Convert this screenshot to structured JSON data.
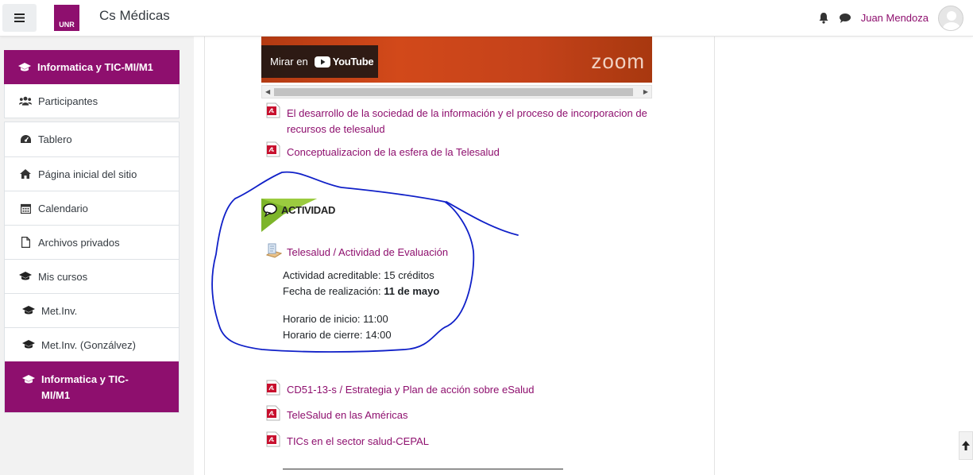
{
  "header": {
    "site_name": "Cs Médicas",
    "logo_text": "UNR",
    "user_name": "Juan Mendoza"
  },
  "drawer": {
    "course_title": "Informatica y TIC-MI/M1",
    "participants": "Participantes",
    "items": [
      {
        "label": "Tablero",
        "icon": "dashboard-icon"
      },
      {
        "label": "Página inicial del sitio",
        "icon": "home-icon"
      },
      {
        "label": "Calendario",
        "icon": "calendar-icon"
      },
      {
        "label": "Archivos privados",
        "icon": "file-icon"
      },
      {
        "label": "Mis cursos",
        "icon": "graduation-cap-icon"
      },
      {
        "label": "Met.Inv.",
        "icon": "graduation-cap-icon"
      },
      {
        "label": "Met.Inv. (Gonzálvez)",
        "icon": "graduation-cap-icon"
      }
    ],
    "active_course": "Informatica y TIC-MI/M1"
  },
  "video": {
    "watch_on": "Mirar en",
    "platform": "YouTube",
    "brand": "zoom"
  },
  "resources_top": [
    {
      "line1": "El desarrollo de la sociedad de la información y el proceso de incorporacion de",
      "line2": "recursos de telesalud"
    },
    {
      "line1": "Conceptualizacion de la esfera de la Telesalud"
    }
  ],
  "activity": {
    "banner": "ACTIVIDAD",
    "link": "Telesalud / Actividad de Evaluación",
    "credits": "Actividad acreditable: 15 créditos",
    "date_label": "Fecha de realización: ",
    "date_value": "11 de mayo",
    "start": "Horario de inicio: 11:00",
    "end": "Horario de cierre: 14:00"
  },
  "resources_bottom": [
    "CD51-13-s / Estrategia y Plan de acción sobre eSalud",
    "TeleSalud en las Américas",
    "TICs en el sector salud-CEPAL"
  ],
  "colors": {
    "brand": "#8e0f6e",
    "annotation": "#1020c8",
    "activity_green": "#7db52a"
  }
}
